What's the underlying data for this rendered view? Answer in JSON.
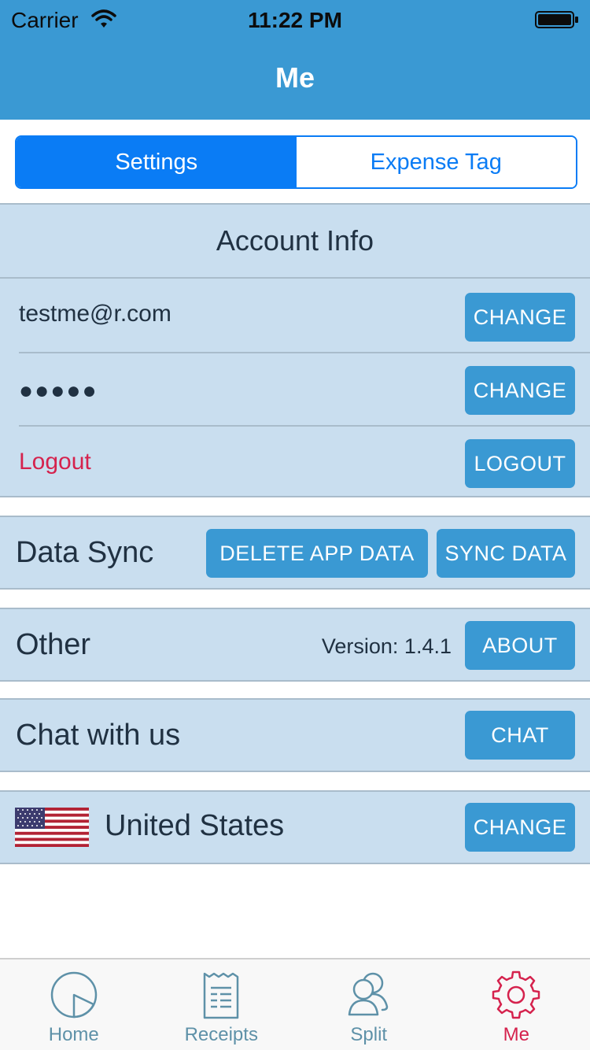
{
  "status_bar": {
    "carrier": "Carrier",
    "time": "11:22 PM"
  },
  "nav": {
    "title": "Me"
  },
  "segments": {
    "settings": "Settings",
    "expense_tag": "Expense Tag"
  },
  "account": {
    "title": "Account Info",
    "email": "testme@r.com",
    "password": "●●●●●",
    "logout_text": "Logout",
    "change_email_label": "CHANGE",
    "change_password_label": "CHANGE",
    "logout_button_label": "LOGOUT"
  },
  "data_sync": {
    "title": "Data Sync",
    "delete_label": "DELETE APP DATA",
    "sync_label": "SYNC DATA"
  },
  "other": {
    "title": "Other",
    "version": "Version: 1.4.1",
    "about_label": "ABOUT"
  },
  "chat": {
    "title": "Chat with us",
    "chat_label": "CHAT"
  },
  "country": {
    "name": "United States",
    "change_label": "CHANGE",
    "flag_icon": "us-flag-icon"
  },
  "tabbar": {
    "items": [
      {
        "label": "Home",
        "icon": "home-pie-icon"
      },
      {
        "label": "Receipts",
        "icon": "receipt-icon"
      },
      {
        "label": "Split",
        "icon": "users-icon"
      },
      {
        "label": "Me",
        "icon": "gear-icon"
      }
    ],
    "active": "Me"
  },
  "colors": {
    "brand": "#3a99d3",
    "section_bg": "#c9deef",
    "segment_blue": "#0a7cf5",
    "accent_red": "#d5224d"
  }
}
